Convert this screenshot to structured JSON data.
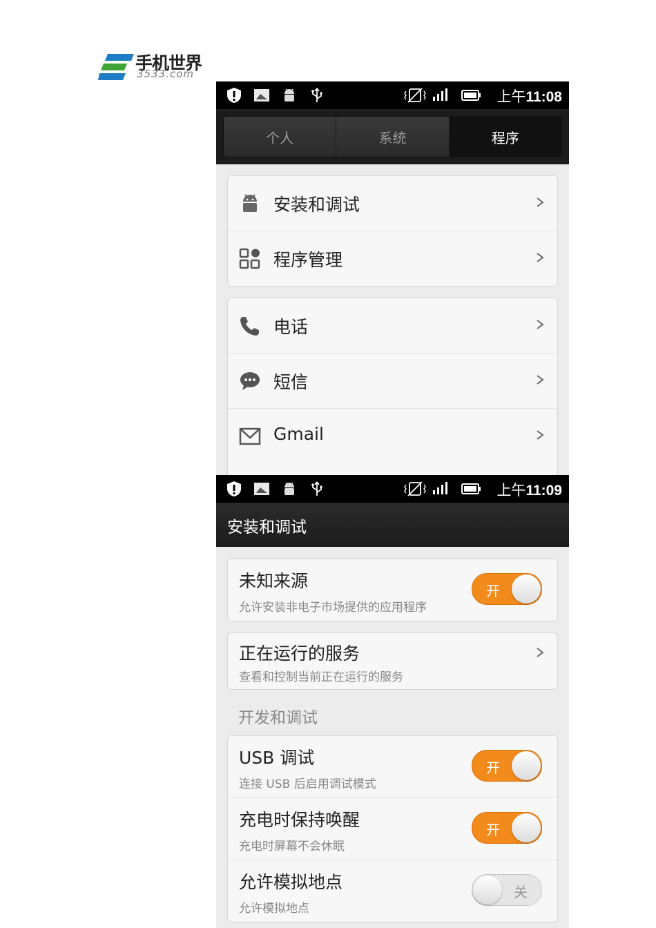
{
  "logo": {
    "cn": "手机世界",
    "en": "3533.com",
    "colors": [
      "#1e7dc6",
      "#3fa535"
    ]
  },
  "screen1": {
    "statusbar": {
      "time_prefix": "上午",
      "time": "11:08",
      "icons": [
        "shield-icon",
        "image-icon",
        "android-icon",
        "usb-icon",
        "vibrate-icon",
        "signal-icon",
        "battery-icon"
      ]
    },
    "tabs": [
      {
        "label": "个人"
      },
      {
        "label": "系统"
      },
      {
        "label": "程序"
      }
    ],
    "active_tab": "程序",
    "groups": [
      {
        "items": [
          {
            "label": "安装和调试",
            "icon": "android-icon"
          },
          {
            "label": "程序管理",
            "icon": "apps-grid-icon"
          }
        ]
      },
      {
        "items": [
          {
            "label": "电话",
            "icon": "phone-icon"
          },
          {
            "label": "短信",
            "icon": "message-icon"
          },
          {
            "label": "Gmail",
            "icon": "mail-icon"
          }
        ]
      }
    ]
  },
  "screen2": {
    "statusbar": {
      "time_prefix": "上午",
      "time": "11:09"
    },
    "title": "安装和调试",
    "unknown_sources": {
      "title": "未知来源",
      "summary": "允许安装非电子市场提供的应用程序",
      "toggle": "开",
      "state": true
    },
    "running_services": {
      "title": "正在运行的服务",
      "summary": "查看和控制当前正在运行的服务"
    },
    "section_header": "开发和调试",
    "dev_items": [
      {
        "title": "USB 调试",
        "summary": "连接 USB 后启用调试模式",
        "toggle": "开",
        "state": true
      },
      {
        "title": "充电时保持唤醒",
        "summary": "充电时屏幕不会休眠",
        "toggle": "开",
        "state": true
      },
      {
        "title": "允许模拟地点",
        "summary": "允许模拟地点",
        "toggle": "关",
        "state": false
      }
    ]
  },
  "colors": {
    "accent": "#f28a1c",
    "bar": "#000000",
    "background": "#ececec"
  }
}
